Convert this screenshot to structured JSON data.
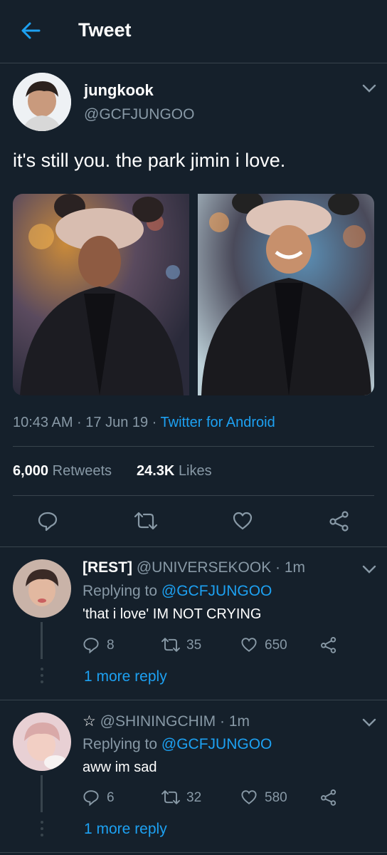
{
  "header": {
    "title": "Tweet"
  },
  "tweet": {
    "author_name": "jungkook",
    "author_handle": "@GCFJUNGOO",
    "text": "it's still you. the park jimin i love.",
    "time": "10:43 AM · 17 Jun 19 · ",
    "source": "Twitter for Android",
    "retweets_count": "6,000",
    "retweets_label": "Retweets",
    "likes_count": "24.3K",
    "likes_label": "Likes"
  },
  "replies": [
    {
      "name": "[REST]",
      "handle": "@UNIVERSEKOOK",
      "time": "· 1m",
      "replying_prefix": "Replying to ",
      "replying_to": "@GCFJUNGOO",
      "text": "'that i love' IM NOT CRYING",
      "reply_count": "8",
      "retweet_count": "35",
      "like_count": "650",
      "more": "1 more reply"
    },
    {
      "name": "☆",
      "handle": "@SHININGCHIM",
      "time": "· 1m",
      "replying_prefix": "Replying to ",
      "replying_to": "@GCFJUNGOO",
      "text": "aww im sad",
      "reply_count": "6",
      "retweet_count": "32",
      "like_count": "580",
      "more": "1 more reply"
    }
  ],
  "colors": {
    "background": "#15202b",
    "accent": "#1da1f2",
    "muted": "#8899a6",
    "divider": "#38444d"
  }
}
